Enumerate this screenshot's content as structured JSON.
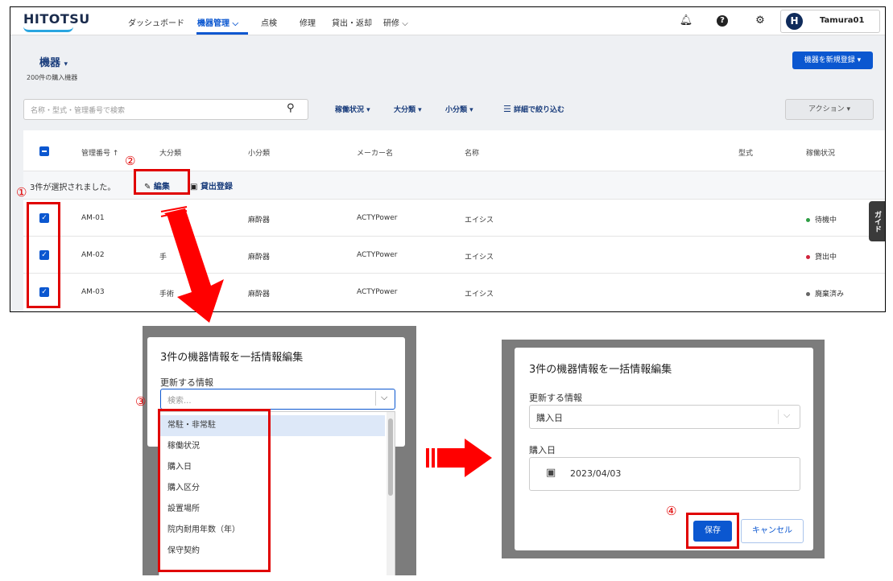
{
  "top": {
    "nav": {
      "logo": "HITOTSU",
      "links": [
        "ダッシュボード",
        "機器管理",
        "点検",
        "修理",
        "貸出・返却",
        "研修"
      ],
      "active": "機器管理",
      "user": "Tamura01",
      "avatar_letter": "H"
    },
    "page": {
      "title": "機器",
      "subtitle": "200件の購入機器",
      "new_button": "機器を新規登録"
    },
    "search": {
      "placeholder": "名称・型式・管理番号で検索"
    },
    "filters": [
      "稼働状況",
      "大分類",
      "小分類"
    ],
    "detail_filter": "詳細で絞り込む",
    "action_button": "アクション",
    "table": {
      "headers": [
        "管理番号 ↑",
        "大分類",
        "小分類",
        "メーカー名",
        "名称",
        "型式",
        "稼働状況"
      ],
      "selection_text": "3件が選択されました。",
      "edit_label": "編集",
      "lend_label": "貸出登録",
      "rows": [
        {
          "id": "AM-01",
          "major": "",
          "minor": "麻酔器",
          "maker": "ACTYPower",
          "name": "エイシス",
          "status": "待機中",
          "status_color": "#2e9e44"
        },
        {
          "id": "AM-02",
          "major": "手",
          "minor": "麻酔器",
          "maker": "ACTYPower",
          "name": "エイシス",
          "status": "貸出中",
          "status_color": "#d0243c"
        },
        {
          "id": "AM-03",
          "major": "手術",
          "minor": "麻酔器",
          "maker": "ACTYPower",
          "name": "エイシス",
          "status": "廃棄済み",
          "status_color": "#666666"
        }
      ]
    },
    "guide": "ガイド"
  },
  "annotations": {
    "n1": "①",
    "n2": "②",
    "n3": "③",
    "n4": "④"
  },
  "modal_left": {
    "title": "3件の機器情報を一括情報編集",
    "field_label": "更新する情報",
    "search_placeholder": "検索...",
    "options": [
      "常駐・非常駐",
      "稼働状況",
      "購入日",
      "購入区分",
      "設置場所",
      "院内耐用年数（年）",
      "保守契約"
    ]
  },
  "modal_right": {
    "title": "3件の機器情報を一括情報編集",
    "field_label": "更新する情報",
    "selected": "購入日",
    "date_label": "購入日",
    "date_value": "2023/04/03",
    "save": "保存",
    "cancel": "キャンセル"
  },
  "colors": {
    "accent": "#0b57d0",
    "annotation": "#e00000"
  }
}
